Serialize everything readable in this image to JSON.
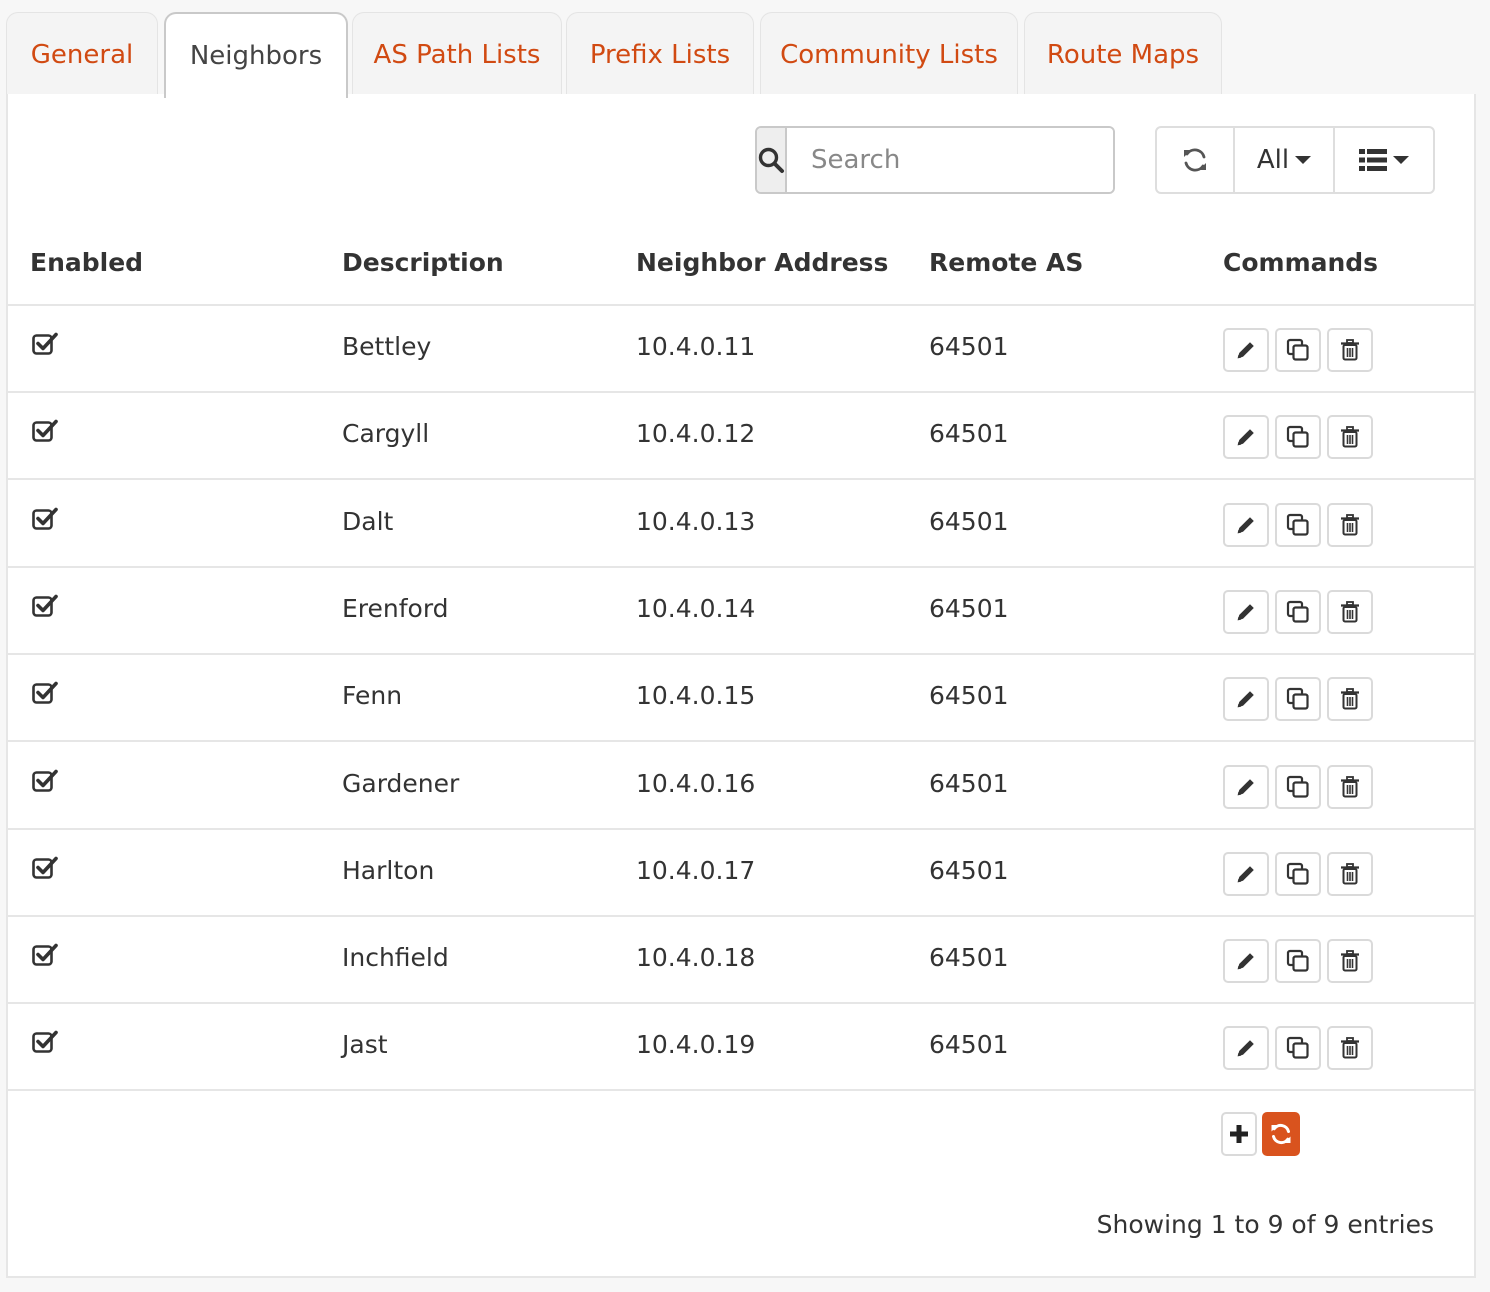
{
  "tabs": [
    {
      "label": "General",
      "active": false
    },
    {
      "label": "Neighbors",
      "active": true
    },
    {
      "label": "AS Path Lists",
      "active": false
    },
    {
      "label": "Prefix Lists",
      "active": false
    },
    {
      "label": "Community Lists",
      "active": false
    },
    {
      "label": "Route Maps",
      "active": false
    }
  ],
  "toolbar": {
    "search_placeholder": "Search",
    "rows_per_page": "All"
  },
  "table": {
    "columns": [
      "Enabled",
      "Description",
      "Neighbor Address",
      "Remote AS",
      "Commands"
    ],
    "rows": [
      {
        "enabled": true,
        "description": "Bettley",
        "address": "10.4.0.11",
        "remote_as": "64501"
      },
      {
        "enabled": true,
        "description": "Cargyll",
        "address": "10.4.0.12",
        "remote_as": "64501"
      },
      {
        "enabled": true,
        "description": "Dalt",
        "address": "10.4.0.13",
        "remote_as": "64501"
      },
      {
        "enabled": true,
        "description": "Erenford",
        "address": "10.4.0.14",
        "remote_as": "64501"
      },
      {
        "enabled": true,
        "description": "Fenn",
        "address": "10.4.0.15",
        "remote_as": "64501"
      },
      {
        "enabled": true,
        "description": "Gardener",
        "address": "10.4.0.16",
        "remote_as": "64501"
      },
      {
        "enabled": true,
        "description": "Harlton",
        "address": "10.4.0.17",
        "remote_as": "64501"
      },
      {
        "enabled": true,
        "description": "Inchfield",
        "address": "10.4.0.18",
        "remote_as": "64501"
      },
      {
        "enabled": true,
        "description": "Jast",
        "address": "10.4.0.19",
        "remote_as": "64501"
      }
    ]
  },
  "footer": {
    "info": "Showing 1 to 9 of 9 entries"
  },
  "colors": {
    "accent": "#d9531e",
    "tab_link": "#d14a12"
  },
  "icons": {
    "search": "search-icon",
    "refresh": "refresh-icon",
    "columns": "list-icon",
    "enabled": "checkbox-checked-icon",
    "edit": "pencil-icon",
    "clone": "clone-icon",
    "delete": "trash-icon",
    "add": "plus-icon",
    "reload": "reload-icon"
  }
}
